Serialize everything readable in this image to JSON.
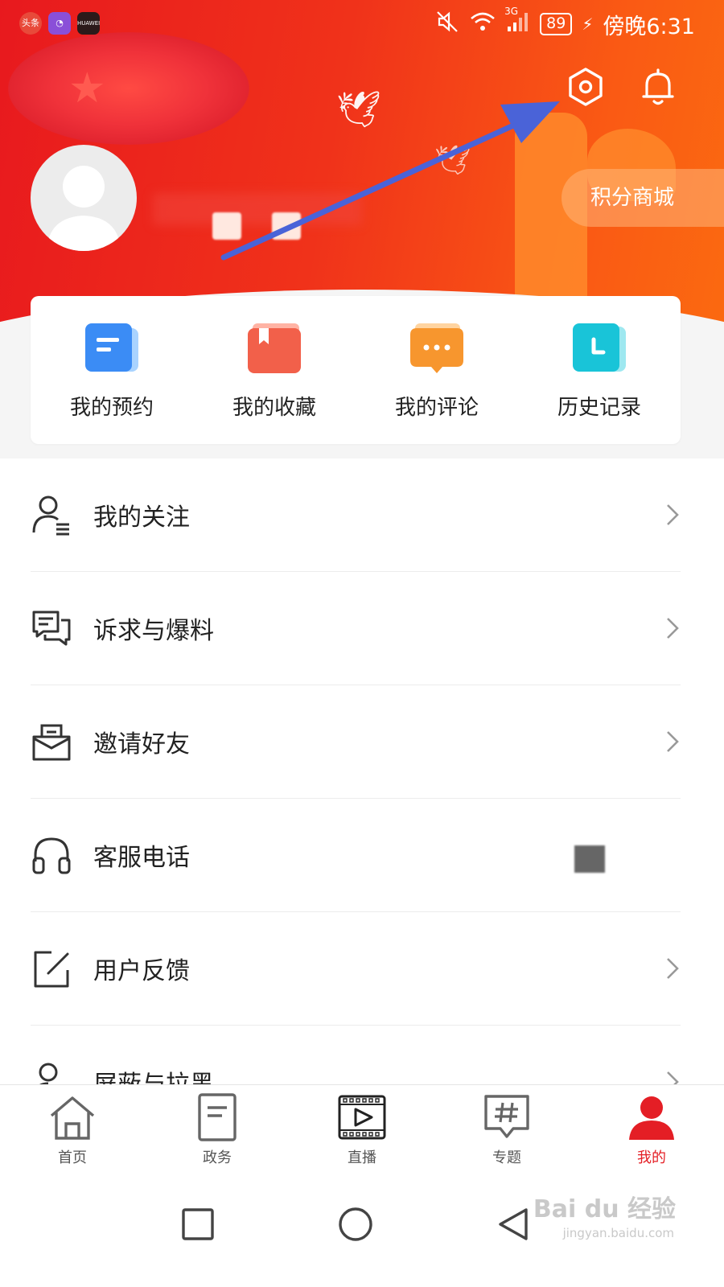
{
  "status_bar": {
    "battery": "89",
    "network": "3G",
    "time": "傍晚6:31",
    "app_icons": [
      "头条",
      "",
      "HUAWEI"
    ]
  },
  "header": {
    "points_mall": "积分商城"
  },
  "quick_actions": [
    {
      "label": "我的预约",
      "icon": "calendar-note-icon",
      "color": "#3b8cf5"
    },
    {
      "label": "我的收藏",
      "icon": "bookmark-book-icon",
      "color": "#f2604a"
    },
    {
      "label": "我的评论",
      "icon": "comment-bubble-icon",
      "color": "#f7962e"
    },
    {
      "label": "历史记录",
      "icon": "clock-icon",
      "color": "#19c4d8"
    }
  ],
  "menu": [
    {
      "label": "我的关注",
      "icon": "user-list-icon"
    },
    {
      "label": "诉求与爆料",
      "icon": "chat-bubbles-icon"
    },
    {
      "label": "邀请好友",
      "icon": "envelope-icon"
    },
    {
      "label": "客服电话",
      "icon": "headphones-icon"
    },
    {
      "label": "用户反馈",
      "icon": "edit-square-icon"
    },
    {
      "label": "屏蔽与拉黑",
      "icon": "user-block-icon"
    }
  ],
  "bottom_nav": [
    {
      "label": "首页",
      "icon": "home-icon"
    },
    {
      "label": "政务",
      "icon": "document-icon"
    },
    {
      "label": "直播",
      "icon": "film-play-icon"
    },
    {
      "label": "专题",
      "icon": "hashtag-icon"
    },
    {
      "label": "我的",
      "icon": "user-filled-icon",
      "active": true
    }
  ],
  "watermark": {
    "title": "Bai du 经验",
    "url": "jingyan.baidu.com"
  },
  "colors": {
    "accent": "#e41e25",
    "header_start": "#e8191e",
    "header_end": "#fb6a10",
    "arrow": "#4a63d8"
  }
}
